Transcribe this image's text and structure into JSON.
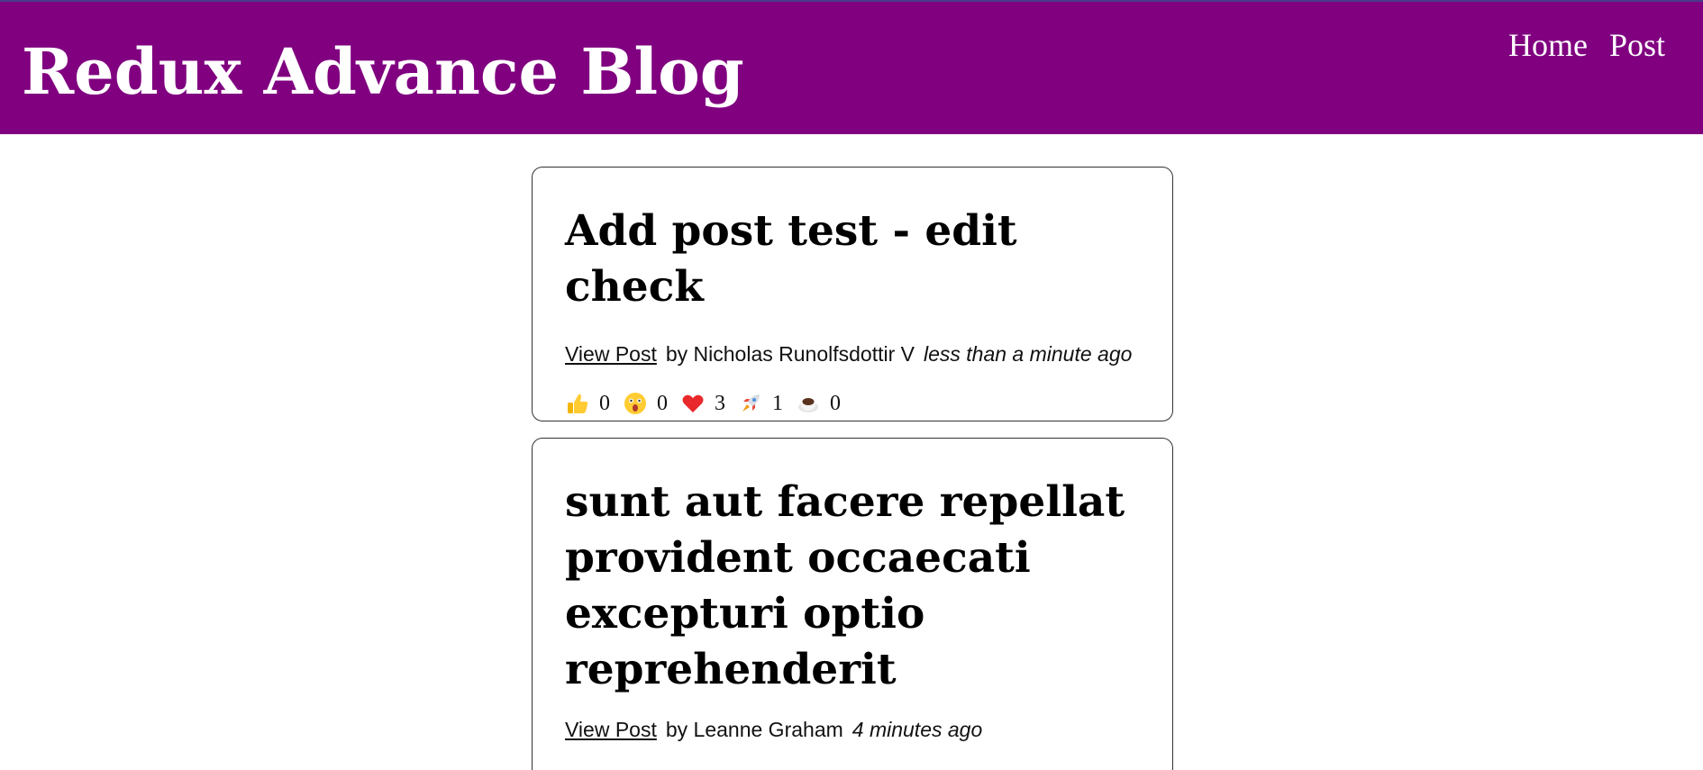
{
  "header": {
    "title": "Redux Advance Blog",
    "nav": [
      {
        "label": "Home"
      },
      {
        "label": "Post"
      }
    ]
  },
  "posts": [
    {
      "title": "Add post test - edit check",
      "view_label": "View Post",
      "author": "by Nicholas Runolfsdottir V",
      "time": "less than a minute ago",
      "reactions": [
        {
          "icon": "thumbs-up-icon",
          "count": "0"
        },
        {
          "icon": "wow-icon",
          "count": "0"
        },
        {
          "icon": "heart-icon",
          "count": "3"
        },
        {
          "icon": "rocket-icon",
          "count": "1"
        },
        {
          "icon": "coffee-icon",
          "count": "0"
        }
      ]
    },
    {
      "title": "sunt aut facere repellat provident occaecati excepturi optio reprehenderit",
      "view_label": "View Post",
      "author": "by Leanne Graham",
      "time": "4 minutes ago"
    }
  ],
  "colors": {
    "header_bg": "#800080",
    "header_text": "#ffffff"
  }
}
